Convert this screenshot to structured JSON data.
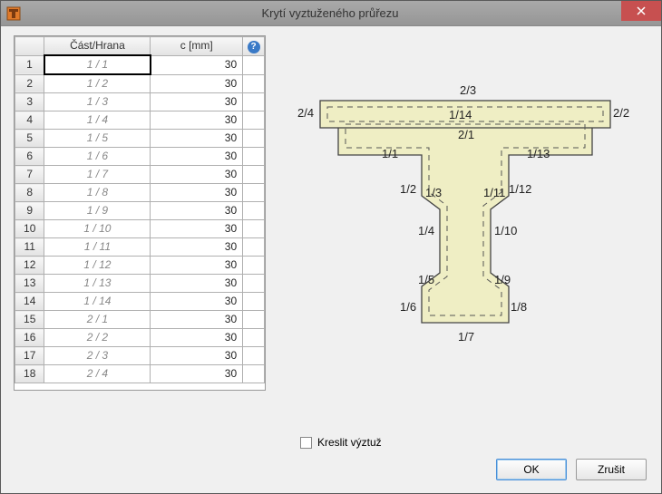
{
  "window": {
    "title": "Krytí vyztuženého průřezu"
  },
  "columns": {
    "edge": "Část/Hrana",
    "c": "c [mm]"
  },
  "rows": [
    {
      "n": "1",
      "edge": "1 / 1",
      "c": "30"
    },
    {
      "n": "2",
      "edge": "1 / 2",
      "c": "30"
    },
    {
      "n": "3",
      "edge": "1 / 3",
      "c": "30"
    },
    {
      "n": "4",
      "edge": "1 / 4",
      "c": "30"
    },
    {
      "n": "5",
      "edge": "1 / 5",
      "c": "30"
    },
    {
      "n": "6",
      "edge": "1 / 6",
      "c": "30"
    },
    {
      "n": "7",
      "edge": "1 / 7",
      "c": "30"
    },
    {
      "n": "8",
      "edge": "1 / 8",
      "c": "30"
    },
    {
      "n": "9",
      "edge": "1 / 9",
      "c": "30"
    },
    {
      "n": "10",
      "edge": "1 / 10",
      "c": "30"
    },
    {
      "n": "11",
      "edge": "1 / 11",
      "c": "30"
    },
    {
      "n": "12",
      "edge": "1 / 12",
      "c": "30"
    },
    {
      "n": "13",
      "edge": "1 / 13",
      "c": "30"
    },
    {
      "n": "14",
      "edge": "1 / 14",
      "c": "30"
    },
    {
      "n": "15",
      "edge": "2 / 1",
      "c": "30"
    },
    {
      "n": "16",
      "edge": "2 / 2",
      "c": "30"
    },
    {
      "n": "17",
      "edge": "2 / 3",
      "c": "30"
    },
    {
      "n": "18",
      "edge": "2 / 4",
      "c": "30"
    }
  ],
  "diagram_labels": {
    "e23": "2/3",
    "e24": "2/4",
    "e22": "2/2",
    "e114": "1/14",
    "e21": "2/1",
    "e11": "1/1",
    "e113": "1/13",
    "e12": "1/2",
    "e13": "1/3",
    "e111": "1/11",
    "e112": "1/12",
    "e14": "1/4",
    "e110": "1/10",
    "e15": "1/5",
    "e19": "1/9",
    "e16": "1/6",
    "e18": "1/8",
    "e17": "1/7"
  },
  "checkbox_label": "Kreslit výztuž",
  "buttons": {
    "ok": "OK",
    "cancel": "Zrušit"
  }
}
